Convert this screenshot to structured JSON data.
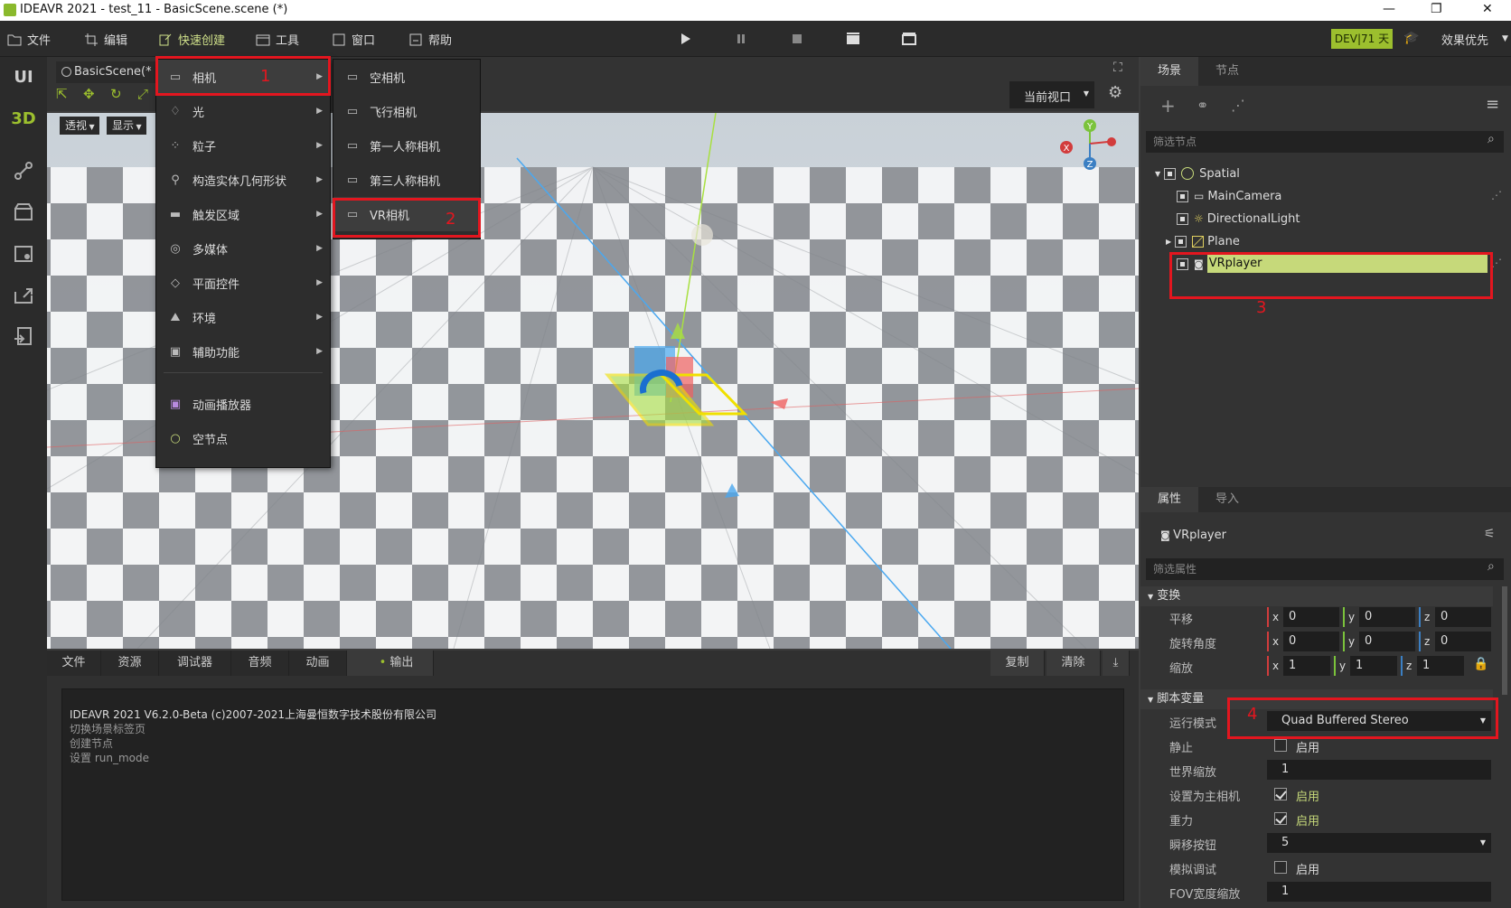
{
  "window": {
    "title": "IDEAVR 2021 - test_11 - BasicScene.scene (*)"
  },
  "menubar": {
    "items": [
      {
        "label": "文件",
        "icon": "folder-icon"
      },
      {
        "label": "编辑",
        "icon": "crop-icon"
      },
      {
        "label": "快速创建",
        "icon": "quick-create-icon"
      },
      {
        "label": "工具",
        "icon": "tools-icon"
      },
      {
        "label": "窗口",
        "icon": "window-icon"
      },
      {
        "label": "帮助",
        "icon": "help-icon"
      }
    ],
    "dev_badge": "DEV|71 天",
    "quality": "效果优先"
  },
  "leftbar": {
    "ui": "UI",
    "three_d": "3D"
  },
  "viewport": {
    "tab": "BasicScene(*",
    "perspective": "透视",
    "display": "显示",
    "current_view": "当前视口"
  },
  "quick_menu": {
    "items": [
      {
        "label": "相机",
        "icon": "camera-icon"
      },
      {
        "label": "光",
        "icon": "light-icon"
      },
      {
        "label": "粒子",
        "icon": "particles-icon"
      },
      {
        "label": "构造实体几何形状",
        "icon": "csg-icon"
      },
      {
        "label": "触发区域",
        "icon": "trigger-icon"
      },
      {
        "label": "多媒体",
        "icon": "media-icon"
      },
      {
        "label": "平面控件",
        "icon": "control-icon"
      },
      {
        "label": "环境",
        "icon": "environment-icon"
      },
      {
        "label": "辅助功能",
        "icon": "toolbox-icon"
      },
      {
        "label": "动画播放器",
        "icon": "animation-icon"
      },
      {
        "label": "空节点",
        "icon": "empty-node-icon"
      }
    ],
    "camera_submenu": [
      {
        "label": "空相机"
      },
      {
        "label": "飞行相机"
      },
      {
        "label": "第一人称相机"
      },
      {
        "label": "第三人称相机"
      },
      {
        "label": "VR相机"
      }
    ]
  },
  "annotations": [
    "1",
    "2",
    "3",
    "4"
  ],
  "bottom": {
    "tabs": [
      "文件",
      "资源",
      "调试器",
      "音频",
      "动画",
      "输出"
    ],
    "copy": "复制",
    "clear": "清除",
    "console": [
      "IDEAVR 2021 V6.2.0-Beta (c)2007-2021上海曼恒数字技术股份有限公司",
      "切换场景标签页",
      "创建节点",
      "设置 run_mode"
    ]
  },
  "scene_panel": {
    "tabs": [
      "场景",
      "节点"
    ],
    "filter_placeholder": "筛选节点",
    "nodes": [
      "Spatial",
      "MainCamera",
      "DirectionalLight",
      "Plane",
      "VRplayer"
    ]
  },
  "inspector": {
    "tabs": [
      "属性",
      "导入"
    ],
    "node_name": "VRplayer",
    "filter_placeholder": "筛选属性",
    "transform_section": "变换",
    "translation": {
      "label": "平移",
      "x": "0",
      "y": "0",
      "z": "0"
    },
    "rotation": {
      "label": "旋转角度",
      "x": "0",
      "y": "0",
      "z": "0"
    },
    "scale": {
      "label": "缩放",
      "x": "1",
      "y": "1",
      "z": "1"
    },
    "script_section": "脚本变量",
    "run_mode": {
      "label": "运行模式",
      "value": "Quad Buffered Stereo"
    },
    "static": {
      "label": "静止",
      "value": "启用",
      "checked": false
    },
    "world_scale": {
      "label": "世界缩放",
      "value": "1"
    },
    "main_camera": {
      "label": "设置为主相机",
      "value": "启用",
      "checked": true
    },
    "gravity": {
      "label": "重力",
      "value": "启用",
      "checked": true
    },
    "teleport_button": {
      "label": "瞬移按钮",
      "value": "5"
    },
    "simulate_debug": {
      "label": "模拟调试",
      "value": "启用",
      "checked": false
    },
    "fov_scale": {
      "label": "FOV宽度缩放",
      "value": "1"
    }
  },
  "gizmo": {
    "y": "Y",
    "z": "Z",
    "x": "X"
  },
  "colors": {
    "accent_green": "#9cbf2e",
    "highlight": "#c6d97a",
    "annotation_red": "#e3161f"
  }
}
